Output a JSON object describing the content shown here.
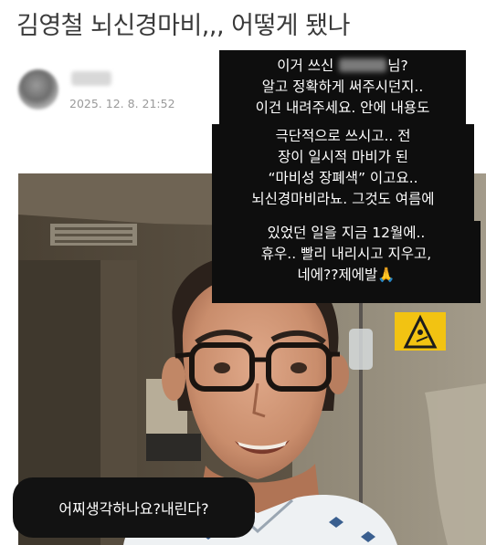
{
  "post": {
    "title": "김영철 뇌신경마비,,, 어떻게 됐나",
    "author_name": "보호",
    "date": "2025. 12. 8. 21:52"
  },
  "story_text": {
    "line1_before": "이거 쓰신",
    "line1_after": "님?",
    "line2": "알고 정확하게 써주시던지..",
    "line3": "이건 내려주세요. 안에 내용도",
    "line4": "극단적으로 쓰시고.. 전",
    "line5": "장이 일시적 마비가 된",
    "line6": "“마비성 장폐색” 이고요..",
    "line7": "뇌신경마비라뇨. 그것도 여름에",
    "line8": "있었던 일을 지금 12월에..",
    "line9": "휴우.. 빨리 내리시고 지우고,",
    "line10": "네에??제에발🙏"
  },
  "comment": {
    "text": "어찌생각하나요?내린다?"
  },
  "photo": {
    "caption_sign": "caution-wet-floor-icon"
  },
  "colors": {
    "story_bg": "#0e0e0e",
    "story_text": "#ffffff",
    "title_text": "#3a3a3a",
    "date_text": "#9a9a9a",
    "sign_yellow": "#f2c312"
  }
}
